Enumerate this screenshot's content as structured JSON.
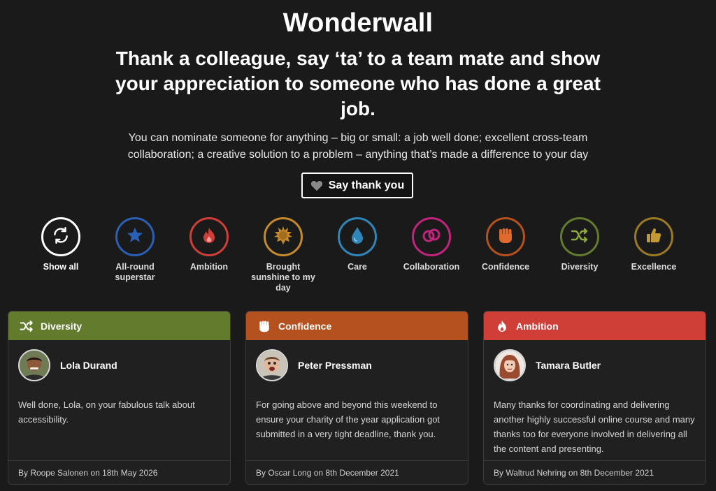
{
  "page": {
    "title": "Wonderwall",
    "headline": "Thank a colleague, say ‘ta’ to a team mate and show your appreciation to someone who has done a great job.",
    "intro": "You can nominate someone for anything – big or small: a  job well done; excellent cross-team collaboration; a creative solution to a problem – anything that’s made a difference to your day",
    "cta_label": "Say thank you"
  },
  "colors": {
    "background": "#1a1a1a",
    "diversity": "#627b2c",
    "confidence": "#b5501f",
    "ambition": "#cf3f38",
    "allround": "#2a5fb4",
    "care": "#2f86b9",
    "collaboration": "#c2247d",
    "sunshine": "#c58a2a",
    "excellence": "#9c7a24"
  },
  "filters": [
    {
      "label": "Show all",
      "icon": "refresh-icon",
      "color": "#ffffff",
      "active": true
    },
    {
      "label": "All-round superstar",
      "icon": "star-icon",
      "color": "#2a5fb4"
    },
    {
      "label": "Ambition",
      "icon": "flame-icon",
      "color": "#cf3f38"
    },
    {
      "label": "Brought sunshine to my day",
      "icon": "sun-icon",
      "color": "#c58a2a"
    },
    {
      "label": "Care",
      "icon": "droplet-icon",
      "color": "#2f86b9"
    },
    {
      "label": "Collaboration",
      "icon": "rings-icon",
      "color": "#c2247d"
    },
    {
      "label": "Confidence",
      "icon": "fist-icon",
      "color": "#b5501f"
    },
    {
      "label": "Diversity",
      "icon": "shuffle-icon",
      "color": "#627b2c"
    },
    {
      "label": "Excellence",
      "icon": "thumbs-up-icon",
      "color": "#9c7a24"
    }
  ],
  "cards": [
    {
      "category": "Diversity",
      "icon": "shuffle-icon",
      "color": "#627b2c",
      "name": "Lola Durand",
      "message": "Well done, Lola, on your fabulous talk about accessibility.",
      "footer": "By Roope Salonen on 18th May 2026"
    },
    {
      "category": "Confidence",
      "icon": "fist-icon",
      "color": "#b5501f",
      "name": "Peter Pressman",
      "message": "For going above and beyond this weekend to ensure your charity of the year application got submitted in a very tight deadline, thank you.",
      "footer": "By Oscar Long on 8th December 2021"
    },
    {
      "category": "Ambition",
      "icon": "flame-icon",
      "color": "#cf3f38",
      "name": "Tamara Butler",
      "message": "Many thanks for coordinating and delivering another highly successful online course and many thanks too for everyone involved in delivering all the content and presenting.",
      "footer": "By Waltrud Nehring on 8th December 2021"
    }
  ]
}
